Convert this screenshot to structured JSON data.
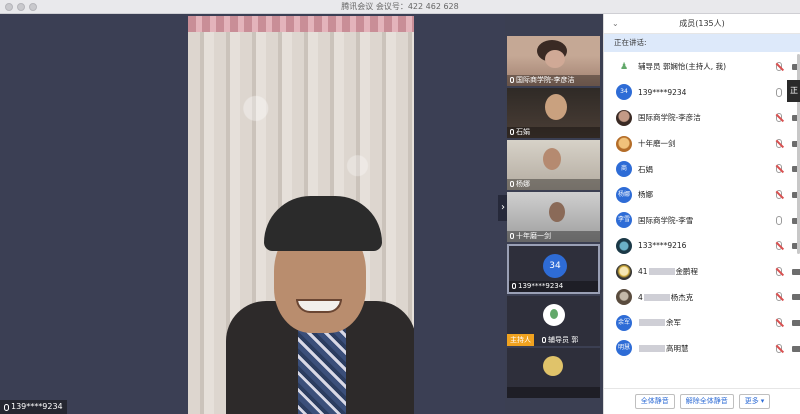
{
  "window": {
    "title": "腾讯会议 会议号：422 462 628"
  },
  "main_video": {
    "name": "139****9234"
  },
  "thumbnails": [
    {
      "name": "国际商学院-李彦洁"
    },
    {
      "name": "石娟"
    },
    {
      "name": "杨娜"
    },
    {
      "name": "十年磨一剑"
    },
    {
      "name": "139****9234",
      "avatar_text": "34"
    },
    {
      "name": "辅导员 郭",
      "badge": "主持人"
    },
    {
      "name": ""
    }
  ],
  "panel": {
    "title": "成员(135人)",
    "speaking_label": "正在讲话:",
    "tooltip_text": "正",
    "members": [
      {
        "name": "辅导员 郭娴怡(主持人, 我)",
        "avatar": "green-person",
        "avatar_text": "♟",
        "muted": true
      },
      {
        "name": "139****9234",
        "avatar": "blue",
        "avatar_text": "34",
        "muted": false
      },
      {
        "name": "国际商学院-李彦洁",
        "avatar": "photo1",
        "avatar_text": "",
        "muted": true
      },
      {
        "name": "十年磨一剑",
        "avatar": "photo2",
        "avatar_text": "",
        "muted": true
      },
      {
        "name": "石娟",
        "avatar": "blue",
        "avatar_text": "商",
        "muted": true
      },
      {
        "name": "杨娜",
        "avatar": "blue",
        "avatar_text": "杨娜",
        "muted": true
      },
      {
        "name": "国际商学院-李雪",
        "avatar": "blue",
        "avatar_text": "李雪",
        "muted": false
      },
      {
        "name": "133****9216",
        "avatar": "photo3",
        "avatar_text": "",
        "muted": true
      },
      {
        "name_prefix": "41",
        "name_suffix": "金鹏程",
        "avatar": "photo4",
        "avatar_text": "",
        "muted": true
      },
      {
        "name_prefix": "4",
        "name_suffix": "杨杰克",
        "avatar": "photo5",
        "avatar_text": "",
        "muted": true
      },
      {
        "name_prefix": "",
        "name_suffix": "余军",
        "avatar": "blue",
        "avatar_text": "余军",
        "muted": true
      },
      {
        "name_prefix": "",
        "name_suffix": "高明慧",
        "avatar": "blue",
        "avatar_text": "明慧",
        "muted": true
      }
    ],
    "footer": {
      "mute_all": "全体静音",
      "unmute_all": "解除全体静音",
      "more": "更多 ▾"
    }
  }
}
